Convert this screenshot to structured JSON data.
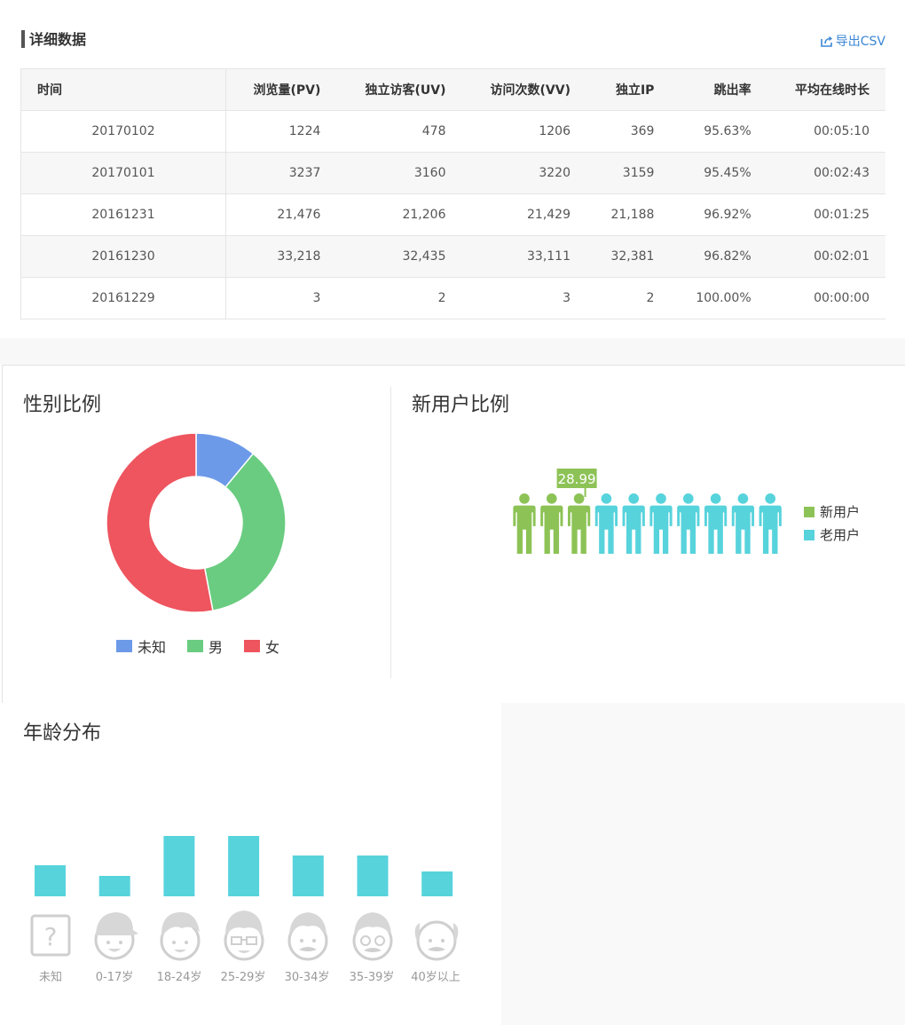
{
  "detail": {
    "title": "详细数据",
    "export_label": "导出CSV",
    "columns": [
      "时间",
      "浏览量(PV)",
      "独立访客(UV)",
      "访问次数(VV)",
      "独立IP",
      "跳出率",
      "平均在线时长"
    ],
    "rows": [
      [
        "20170102",
        "1224",
        "478",
        "1206",
        "369",
        "95.63%",
        "00:05:10"
      ],
      [
        "20170101",
        "3237",
        "3160",
        "3220",
        "3159",
        "95.45%",
        "00:02:43"
      ],
      [
        "20161231",
        "21,476",
        "21,206",
        "21,429",
        "21,188",
        "96.92%",
        "00:01:25"
      ],
      [
        "20161230",
        "33,218",
        "32,435",
        "33,111",
        "32,381",
        "96.82%",
        "00:02:01"
      ],
      [
        "20161229",
        "3",
        "2",
        "3",
        "2",
        "100.00%",
        "00:00:00"
      ]
    ]
  },
  "gender": {
    "title": "性别比例",
    "legend": [
      {
        "label": "未知",
        "color": "#6c9ae8"
      },
      {
        "label": "男",
        "color": "#6acc80"
      },
      {
        "label": "女",
        "color": "#ee555f"
      }
    ]
  },
  "new_user": {
    "title": "新用户比例",
    "badge": "28.999",
    "new_color": "#8dc356",
    "old_color": "#57d3dc",
    "legend": [
      {
        "label": "新用户",
        "color": "#8dc356"
      },
      {
        "label": "老用户",
        "color": "#57d3dc"
      }
    ]
  },
  "age": {
    "title": "年龄分布",
    "bar_color": "#57d3dc",
    "labels": [
      "未知",
      "0-17岁",
      "18-24岁",
      "25-29岁",
      "30-34岁",
      "35-39岁",
      "40岁以上"
    ]
  },
  "chart_data": [
    {
      "type": "pie",
      "title": "性别比例",
      "categories": [
        "未知",
        "男",
        "女"
      ],
      "values": [
        11,
        36,
        53
      ]
    },
    {
      "type": "bar",
      "title": "新用户比例",
      "categories": [
        "新用户",
        "老用户"
      ],
      "values": [
        29,
        71
      ]
    },
    {
      "type": "bar",
      "title": "年龄分布",
      "categories": [
        "未知",
        "0-17岁",
        "18-24岁",
        "25-29岁",
        "30-34岁",
        "35-39岁",
        "40岁以上"
      ],
      "values": [
        35,
        23,
        68,
        68,
        46,
        46,
        28
      ]
    }
  ]
}
